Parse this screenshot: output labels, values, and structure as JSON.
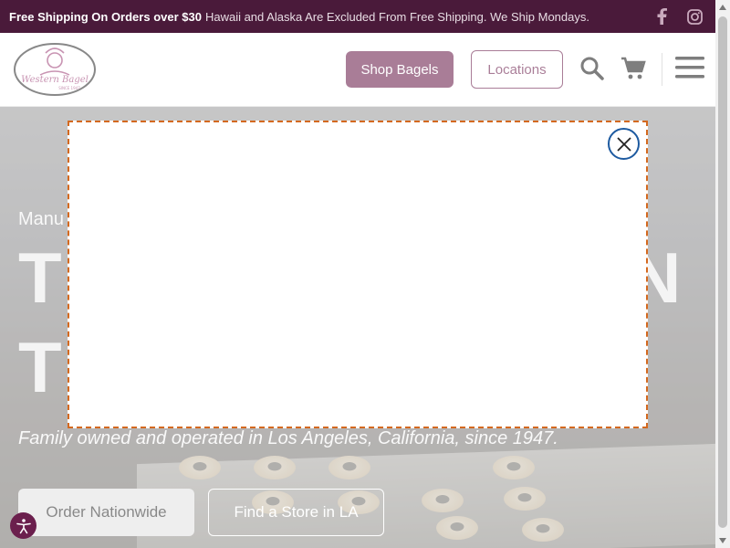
{
  "announcement": {
    "bold": "Free Shipping On Orders over $30",
    "rest": "Hawaii and Alaska Are Excluded From Free Shipping. We Ship Mondays."
  },
  "social": {
    "facebook_icon": "facebook-icon",
    "instagram_icon": "instagram-icon"
  },
  "header": {
    "logo_text": "Western Bagel",
    "logo_subtext": "SINCE 1947",
    "shop_label": "Shop Bagels",
    "locations_label": "Locations",
    "icons": [
      "search-icon",
      "cart-icon",
      "menu-icon"
    ]
  },
  "hero": {
    "subtitle": "Manu",
    "title_line1_left": "T",
    "title_line1_right": "N",
    "title_line2_left": "T",
    "tagline": "Family owned and operated in Los Angeles, California, since 1947.",
    "order_label": "Order Nationwide",
    "find_label": "Find a Store in LA"
  },
  "modal": {
    "close_icon": "close-icon"
  },
  "accessibility": {
    "icon": "accessibility-icon"
  },
  "colors": {
    "brand": "#6b1f4d",
    "announce_bg": "#4a1a3a",
    "modal_border": "#d4691f",
    "close_ring": "#1d5aa0"
  }
}
